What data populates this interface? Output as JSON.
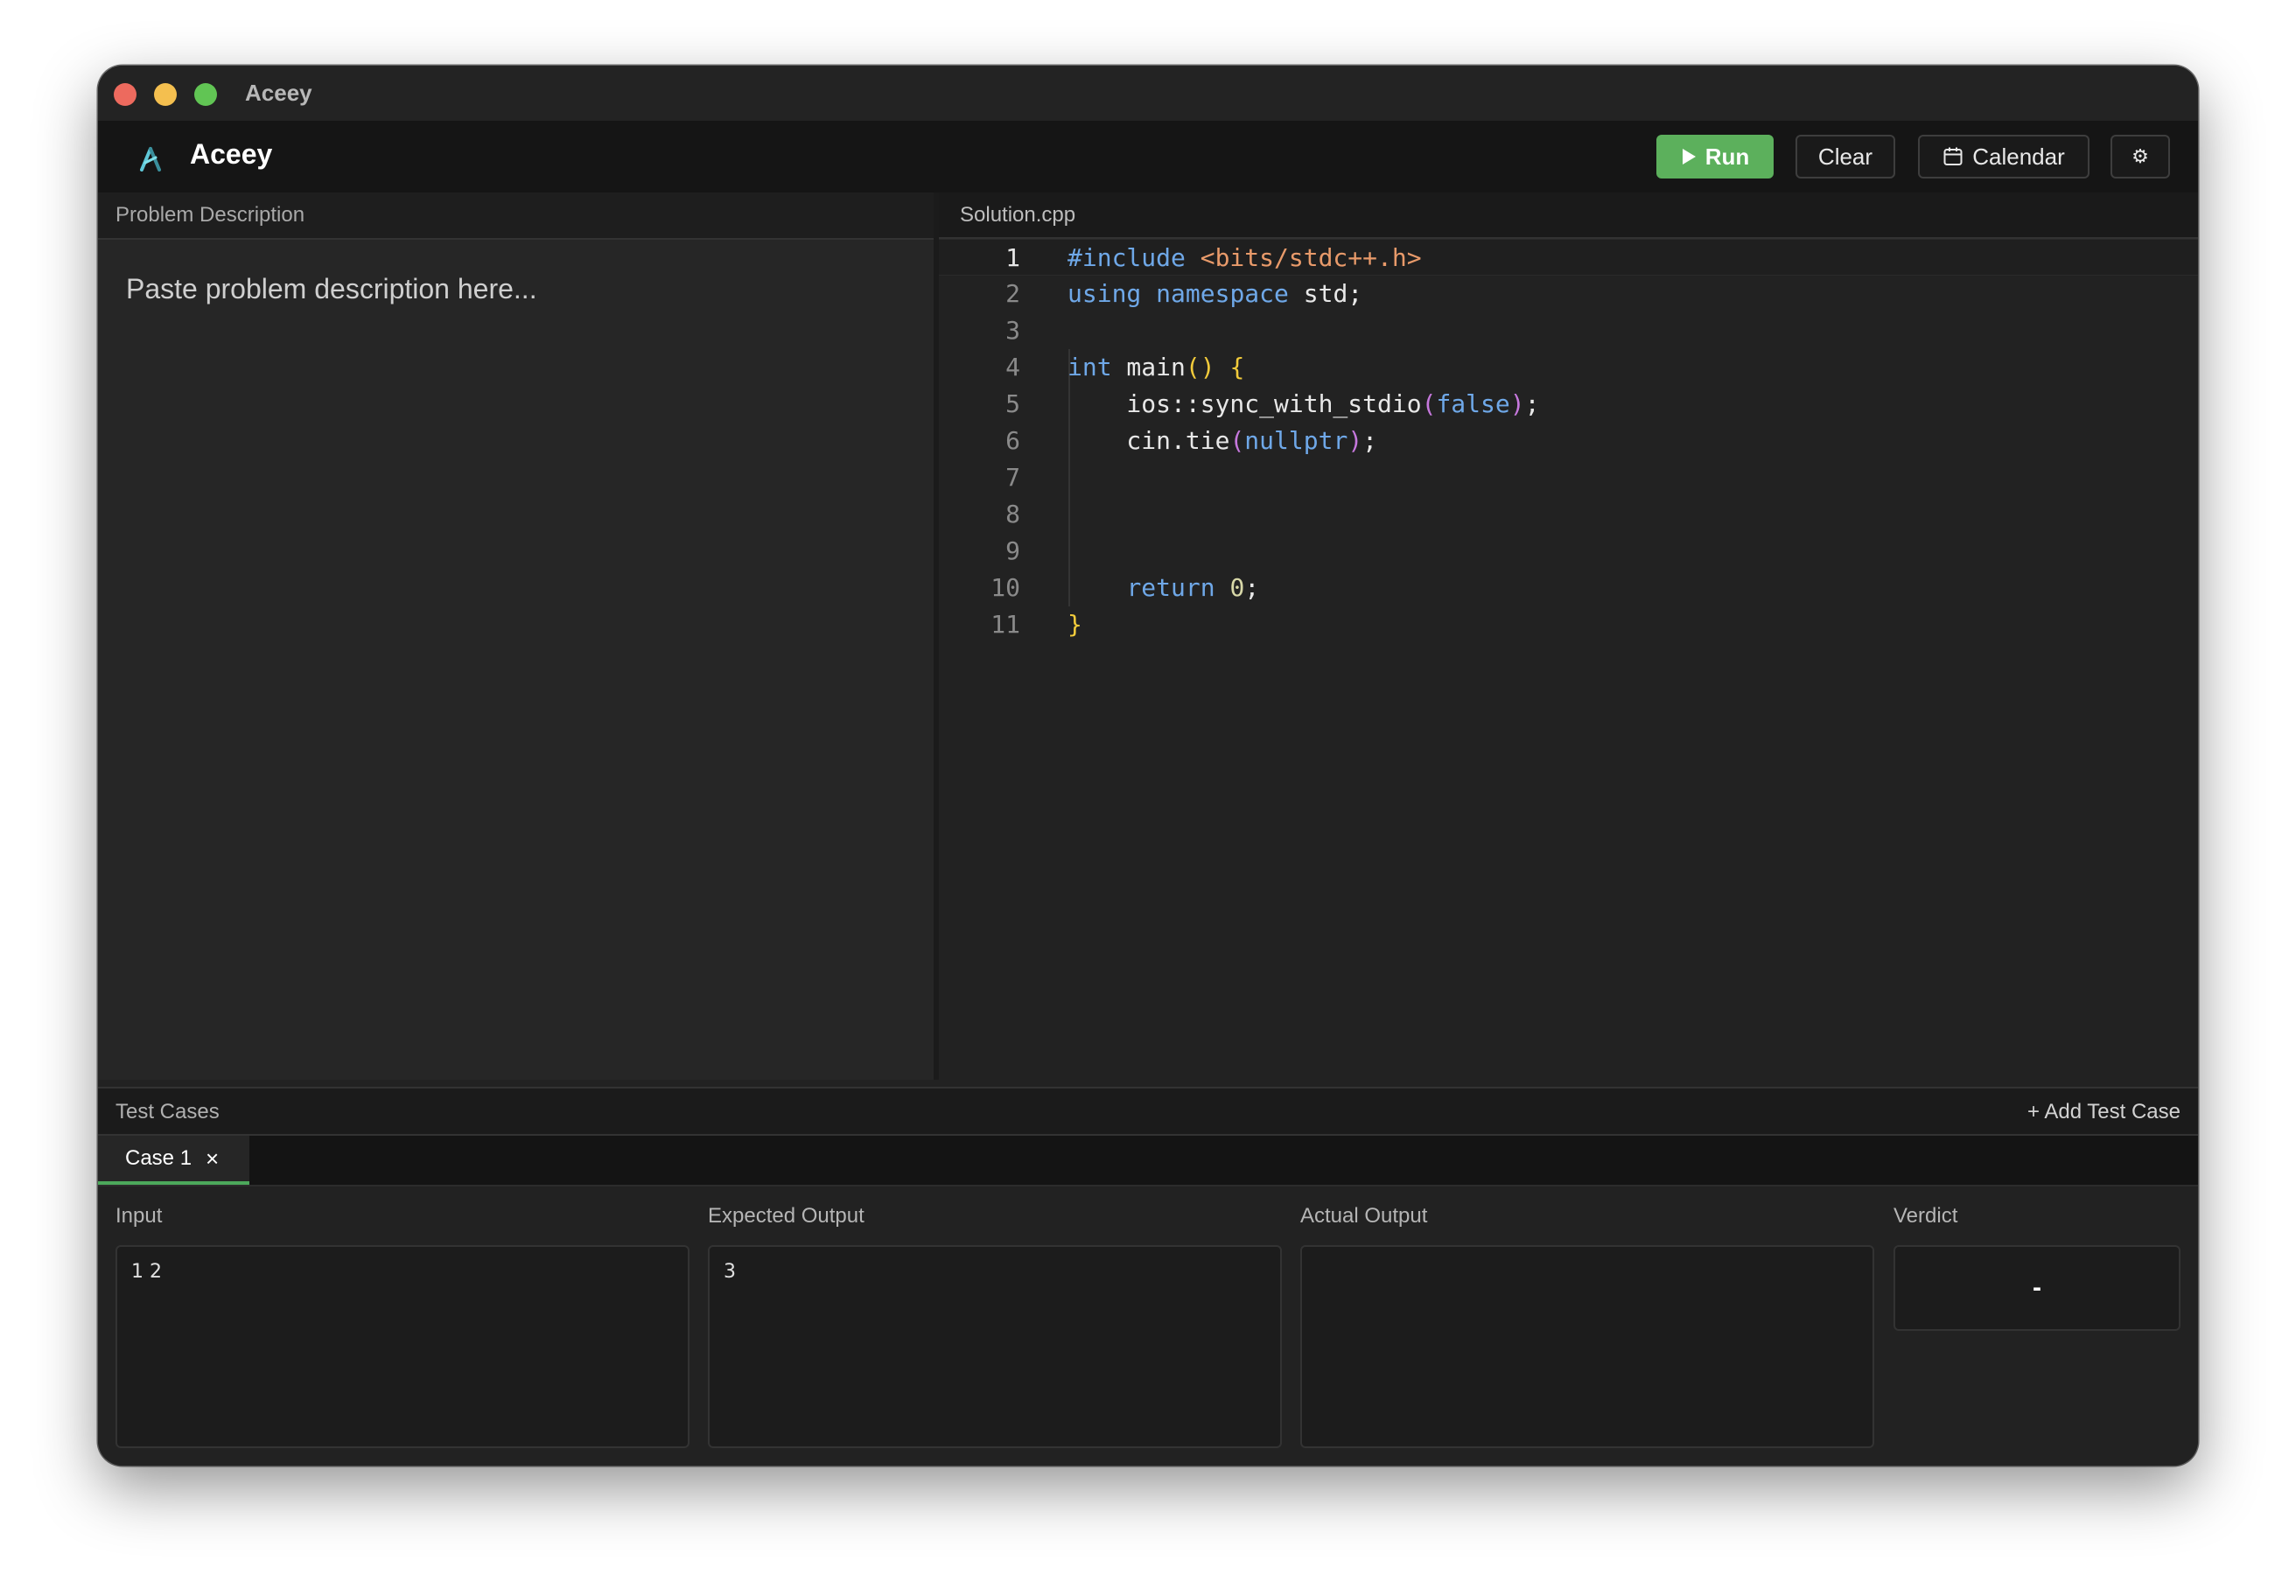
{
  "window": {
    "title": "Aceey"
  },
  "toolbar": {
    "app_name": "Aceey",
    "run_label": "Run",
    "clear_label": "Clear",
    "calendar_label": "Calendar",
    "settings_glyph": "⚙"
  },
  "problem": {
    "header": "Problem Description",
    "placeholder": "Paste problem description here..."
  },
  "editor": {
    "filename": "Solution.cpp",
    "active_line": 1,
    "line_numbers": [
      "1",
      "2",
      "3",
      "4",
      "5",
      "6",
      "7",
      "8",
      "9",
      "10",
      "11"
    ]
  },
  "tests": {
    "header": "Test Cases",
    "add_label": "+ Add Test Case",
    "tabs": [
      {
        "label": "Case 1",
        "close": "×"
      }
    ],
    "input_label": "Input",
    "input_value": "1 2",
    "expected_label": "Expected Output",
    "expected_value": "3",
    "actual_label": "Actual Output",
    "actual_value": "",
    "verdict_label": "Verdict",
    "verdict_value": "-"
  },
  "colors": {
    "run_button": "#5cb05c",
    "active_tab_underline": "#4ca85b",
    "keyword": "#6fa8e8",
    "string": "#e89a6a",
    "bracket": "#f2cb3b"
  }
}
